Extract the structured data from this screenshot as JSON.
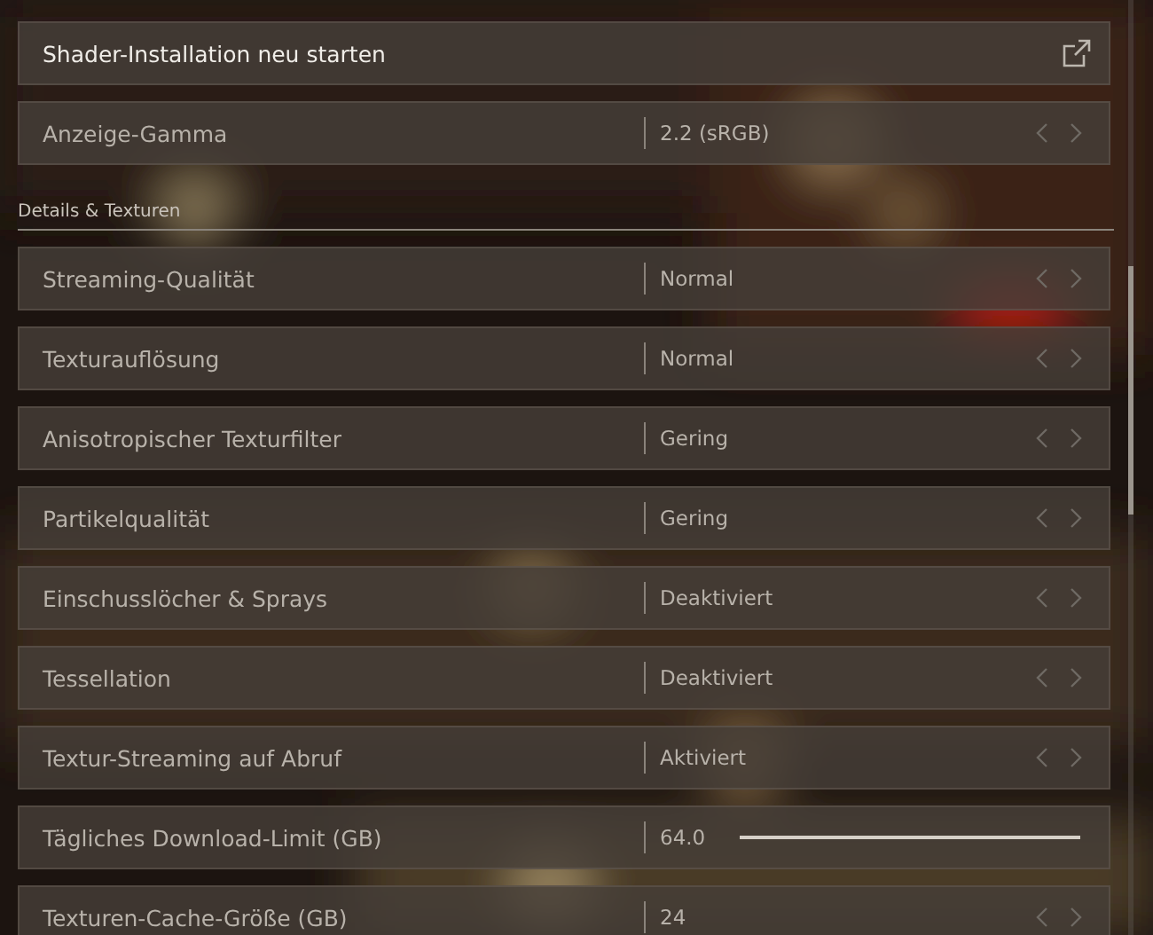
{
  "top_rows": [
    {
      "kind": "action",
      "label": "Shader-Installation neu starten"
    },
    {
      "kind": "select",
      "label": "Anzeige-Gamma",
      "value": "2.2 (sRGB)"
    }
  ],
  "section": {
    "title": "Details & Texturen",
    "rows": [
      {
        "kind": "select",
        "label": "Streaming-Qualität",
        "value": "Normal"
      },
      {
        "kind": "select",
        "label": "Texturauflösung",
        "value": "Normal"
      },
      {
        "kind": "select",
        "label": "Anisotropischer Texturfilter",
        "value": "Gering"
      },
      {
        "kind": "select",
        "label": "Partikelqualität",
        "value": "Gering"
      },
      {
        "kind": "select",
        "label": "Einschusslöcher & Sprays",
        "value": "Deaktiviert"
      },
      {
        "kind": "select",
        "label": "Tessellation",
        "value": "Deaktiviert"
      },
      {
        "kind": "select",
        "label": "Textur-Streaming auf Abruf",
        "value": "Aktiviert"
      },
      {
        "kind": "slider",
        "label": "Tägliches Download-Limit (GB)",
        "value": "64.0",
        "level": 1
      },
      {
        "kind": "select",
        "label": "Texturen-Cache-Größe (GB)",
        "value": "24"
      }
    ]
  }
}
